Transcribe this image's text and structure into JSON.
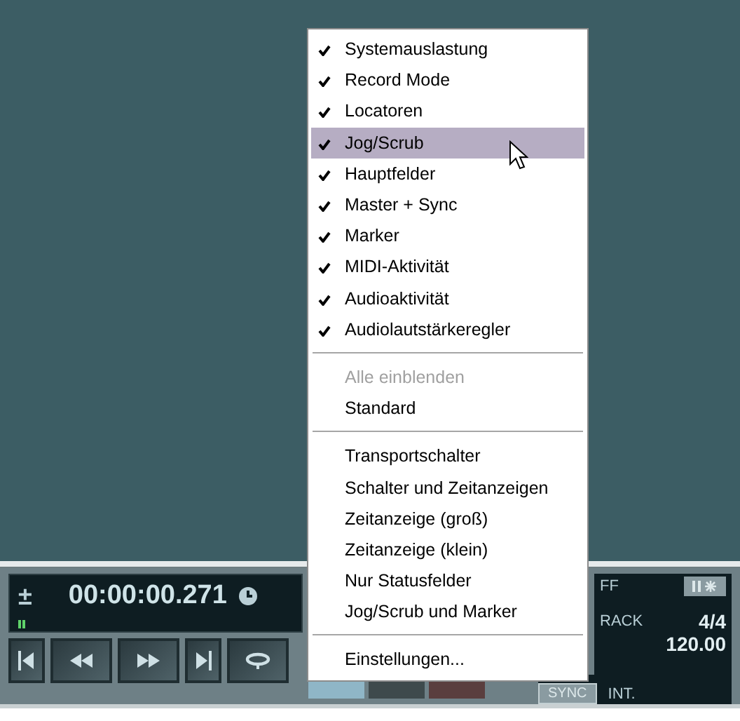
{
  "menu": {
    "items": [
      {
        "kind": "check",
        "label": "Systemauslastung",
        "checked": true,
        "selected": false,
        "disabled": false
      },
      {
        "kind": "check",
        "label": "Record Mode",
        "checked": true,
        "selected": false,
        "disabled": false
      },
      {
        "kind": "check",
        "label": "Locatoren",
        "checked": true,
        "selected": false,
        "disabled": false
      },
      {
        "kind": "check",
        "label": "Jog/Scrub",
        "checked": true,
        "selected": true,
        "disabled": false
      },
      {
        "kind": "check",
        "label": "Hauptfelder",
        "checked": true,
        "selected": false,
        "disabled": false
      },
      {
        "kind": "check",
        "label": "Master + Sync",
        "checked": true,
        "selected": false,
        "disabled": false
      },
      {
        "kind": "check",
        "label": "Marker",
        "checked": true,
        "selected": false,
        "disabled": false
      },
      {
        "kind": "check",
        "label": "MIDI-Aktivität",
        "checked": true,
        "selected": false,
        "disabled": false
      },
      {
        "kind": "check",
        "label": "Audioaktivität",
        "checked": true,
        "selected": false,
        "disabled": false
      },
      {
        "kind": "check",
        "label": "Audiolautstärkeregler",
        "checked": true,
        "selected": false,
        "disabled": false
      },
      {
        "kind": "separator"
      },
      {
        "kind": "plain",
        "label": "Alle einblenden",
        "selected": false,
        "disabled": true
      },
      {
        "kind": "plain",
        "label": "Standard",
        "selected": false,
        "disabled": false
      },
      {
        "kind": "separator"
      },
      {
        "kind": "plain",
        "label": "Transportschalter",
        "selected": false,
        "disabled": false
      },
      {
        "kind": "plain",
        "label": "Schalter und Zeitanzeigen",
        "selected": false,
        "disabled": false
      },
      {
        "kind": "plain",
        "label": "Zeitanzeige (groß)",
        "selected": false,
        "disabled": false
      },
      {
        "kind": "plain",
        "label": "Zeitanzeige (klein)",
        "selected": false,
        "disabled": false
      },
      {
        "kind": "plain",
        "label": "Nur Statusfelder",
        "selected": false,
        "disabled": false
      },
      {
        "kind": "plain",
        "label": "Jog/Scrub und Marker",
        "selected": false,
        "disabled": false
      },
      {
        "kind": "separator"
      },
      {
        "kind": "plain",
        "label": "Einstellungen...",
        "selected": false,
        "disabled": false
      }
    ]
  },
  "transport": {
    "plus_minus": "±",
    "time": "00:00:00.271",
    "status": {
      "click": "FF",
      "track": "RACK",
      "signature": "4/4",
      "tempo": "120.00",
      "sync": "SYNC",
      "sync_mode": "INT."
    }
  }
}
